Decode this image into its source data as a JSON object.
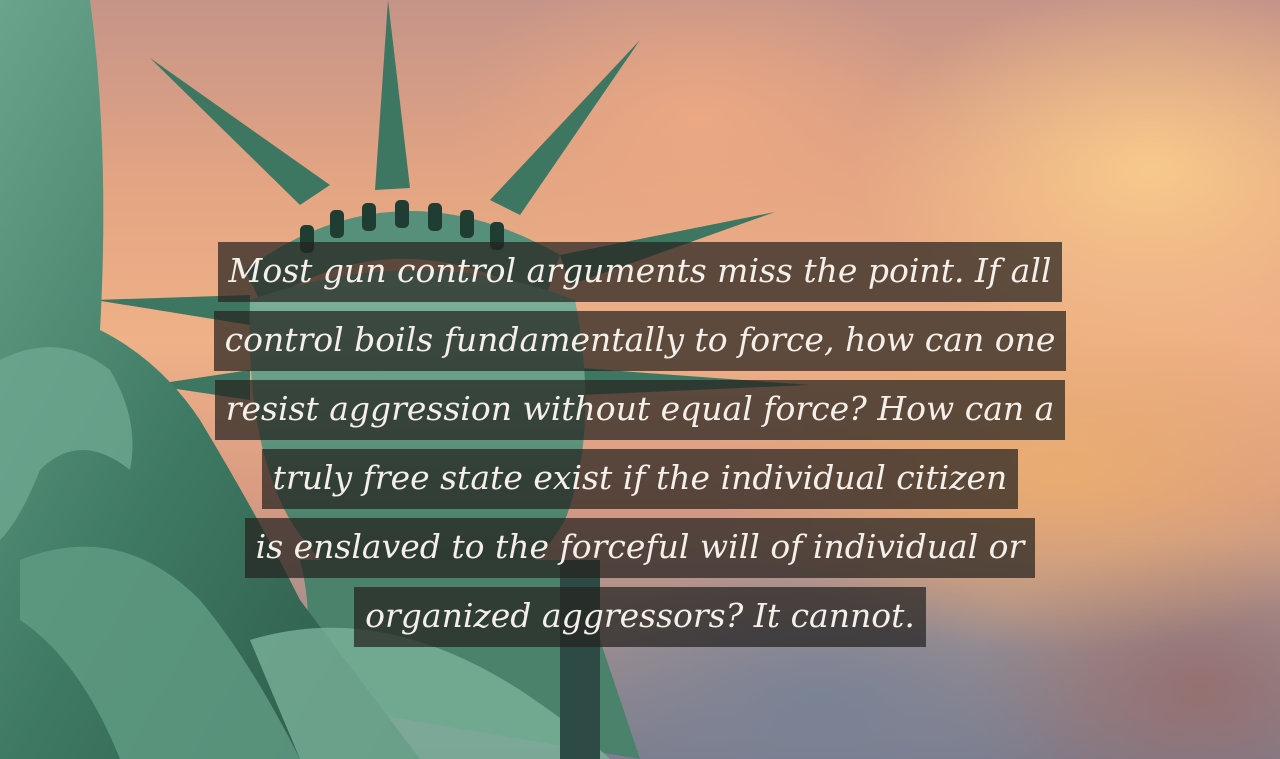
{
  "quote": {
    "lines": [
      "Most gun control arguments miss the point. If all",
      "control boils fundamentally to force, how can one",
      "resist aggression without equal force? How can a",
      "truly free state exist if the individual citizen",
      "is enslaved to the forceful will of individual or",
      "organized aggressors? It cannot."
    ]
  },
  "background": {
    "subject": "statue-of-liberty",
    "sky_colors": [
      "#efb187",
      "#d99b82",
      "#7d7e8e"
    ],
    "statue_color": "#4e8a73"
  }
}
